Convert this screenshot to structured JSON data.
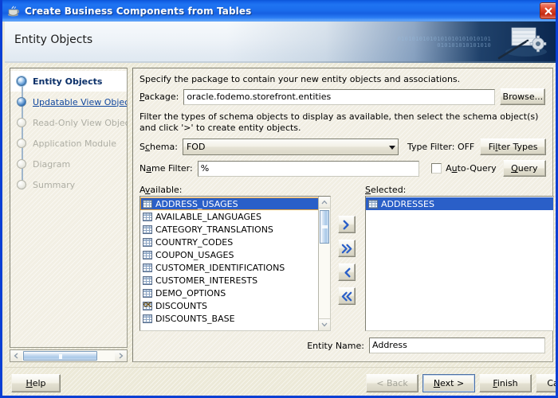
{
  "window": {
    "title": "Create Business Components from Tables",
    "icon": "java-coffee-cup-icon",
    "close_label": "Close",
    "frame_color": "#0a3fd4",
    "titlebar_color": "#1b6cec"
  },
  "banner": {
    "title": "Entity Objects",
    "binary_line1": "01010101010101010101010101",
    "binary_line2": "010101010101010",
    "art": "table-pen-gear-graphic"
  },
  "sidebar": {
    "items": [
      {
        "label": "Entity Objects",
        "state": "active"
      },
      {
        "label": "Updatable View Objects",
        "state": "link"
      },
      {
        "label": "Read-Only View Objects",
        "state": "disabled"
      },
      {
        "label": "Application Module",
        "state": "disabled"
      },
      {
        "label": "Diagram",
        "state": "disabled"
      },
      {
        "label": "Summary",
        "state": "disabled"
      }
    ],
    "scroll_left_icon": "chevron-left-icon",
    "scroll_right_icon": "chevron-right-icon"
  },
  "content": {
    "package_description": "Specify the package to contain your new entity objects and associations.",
    "package_label": "Package:",
    "package_value": "oracle.fodemo.storefront.entities",
    "browse_label": "Browse...",
    "filter_description": "Filter the types of schema objects to display as available, then select the schema object(s) and click '>' to create entity objects.",
    "schema_label": "Schema:",
    "schema_value": "FOD",
    "type_filter_status": "Type Filter: OFF",
    "filter_types_label": "Filter Types",
    "name_filter_label": "Name Filter:",
    "name_filter_value": "%",
    "auto_query_label": "Auto-Query",
    "auto_query_checked": false,
    "query_label": "Query",
    "available_label": "Available:",
    "selected_label": "Selected:",
    "available_items": [
      {
        "name": "ADDRESS_USAGES",
        "icon": "table-icon",
        "selected": true
      },
      {
        "name": "AVAILABLE_LANGUAGES",
        "icon": "table-icon",
        "selected": false
      },
      {
        "name": "CATEGORY_TRANSLATIONS",
        "icon": "table-icon",
        "selected": false
      },
      {
        "name": "COUNTRY_CODES",
        "icon": "table-icon",
        "selected": false
      },
      {
        "name": "COUPON_USAGES",
        "icon": "table-icon",
        "selected": false
      },
      {
        "name": "CUSTOMER_IDENTIFICATIONS",
        "icon": "table-icon",
        "selected": false
      },
      {
        "name": "CUSTOMER_INTERESTS",
        "icon": "table-icon",
        "selected": false
      },
      {
        "name": "DEMO_OPTIONS",
        "icon": "table-icon",
        "selected": false
      },
      {
        "name": "DISCOUNTS",
        "icon": "view-icon",
        "selected": false
      },
      {
        "name": "DISCOUNTS_BASE",
        "icon": "table-icon",
        "selected": false
      }
    ],
    "selected_items": [
      {
        "name": "ADDRESSES",
        "icon": "table-icon",
        "selected": true
      }
    ],
    "transfer_buttons": [
      {
        "name": "move-right-button",
        "icon": "chevron-right-icon"
      },
      {
        "name": "move-all-right-button",
        "icon": "chevron-double-right-icon"
      },
      {
        "name": "move-left-button",
        "icon": "chevron-left-icon"
      },
      {
        "name": "move-all-left-button",
        "icon": "chevron-double-left-icon"
      }
    ],
    "entity_name_label": "Entity Name:",
    "entity_name_value": "Address",
    "selection_highlight_color": "#2a5fc8",
    "focus_outline_color": "#e8a23a"
  },
  "footer": {
    "help_label": "Help",
    "back_label": "< Back",
    "back_disabled": true,
    "next_label": "Next >",
    "next_focused": true,
    "finish_label": "Finish",
    "cancel_label": "Cancel"
  }
}
